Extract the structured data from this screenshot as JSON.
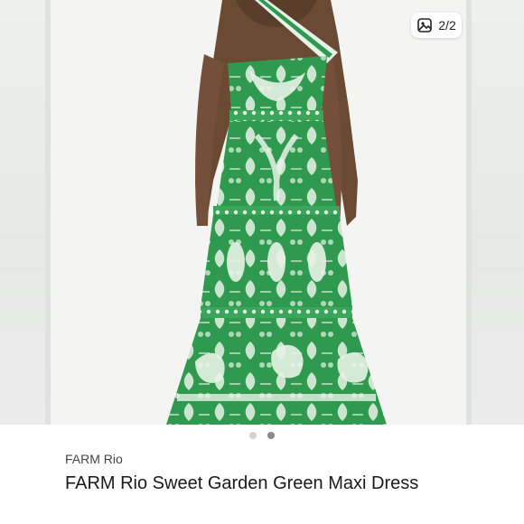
{
  "listing": {
    "photo_alt": "Green maxi dress back view",
    "counter": {
      "icon": "image-gallery-icon",
      "text": "2/2"
    },
    "pager": {
      "total": 2,
      "active_index": 1
    },
    "brand": "FARM Rio",
    "title": "FARM Rio Sweet Garden Green Maxi Dress"
  },
  "colors": {
    "dress_green": "#2f9a4f",
    "print_white": "#e8f2e6",
    "backdrop": "#f4f4f2"
  }
}
